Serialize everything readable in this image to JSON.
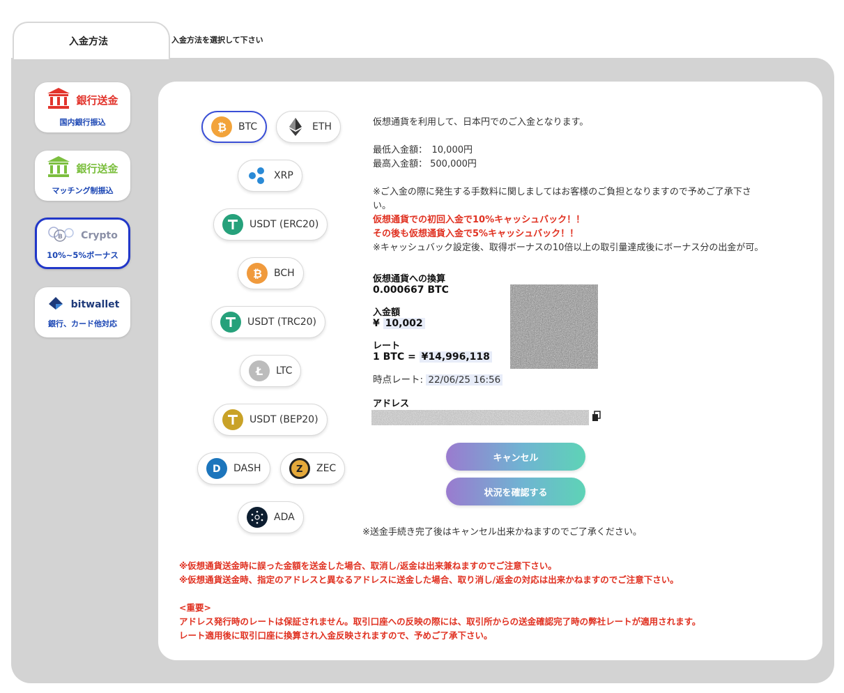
{
  "tabs": {
    "active_label": "入金方法",
    "hint": "入金方法を選択して下さい"
  },
  "methods": [
    {
      "name": "銀行送金",
      "sub": "国内銀行振込",
      "icon": "bank-icon"
    },
    {
      "name": "銀行送金",
      "sub": "マッチング制振込",
      "icon": "bank-icon"
    },
    {
      "name": "Crypto",
      "sub": "10%~5%ボーナス",
      "icon": "crypto-coins-icon",
      "selected": true
    },
    {
      "name": "bitwallet",
      "sub": "銀行、カード他対応",
      "icon": "bitwallet-icon"
    }
  ],
  "coins": [
    {
      "label": "BTC",
      "icon": "bitcoin-icon",
      "color": "#f2a33a",
      "selected": true
    },
    {
      "label": "ETH",
      "icon": "ethereum-icon",
      "color": "#3c3c3d"
    },
    {
      "label": "XRP",
      "icon": "xrp-icon",
      "color": "#2a8ad6"
    },
    {
      "label": "USDT (ERC20)",
      "icon": "tether-icon",
      "color": "#26a17b"
    },
    {
      "label": "BCH",
      "icon": "bitcoin-cash-icon",
      "color": "#f09a3c"
    },
    {
      "label": "USDT (TRC20)",
      "icon": "tether-tron-icon",
      "color": "#26a17b"
    },
    {
      "label": "LTC",
      "icon": "litecoin-icon",
      "color": "#bcbcbc"
    },
    {
      "label": "USDT (BEP20)",
      "icon": "tether-bep20-icon",
      "color": "#c9a227"
    },
    {
      "label": "DASH",
      "icon": "dash-icon",
      "color": "#1c75bc"
    },
    {
      "label": "ZEC",
      "icon": "zcash-icon",
      "color": "#e5a93b"
    },
    {
      "label": "ADA",
      "icon": "cardano-icon",
      "color": "#0d1e30"
    }
  ],
  "info": {
    "intro": "仮想通貨を利用して、日本円でのご入金となります。",
    "min_deposit": "最低入金額：　10,000円",
    "max_deposit": "最高入金額：  500,000円",
    "fee_note_1": "※ご入金の際に発生する手数料に関しましてはお客様のご負担となりますので予めご了承下さ",
    "fee_note_2": "い。",
    "cashback_1": "仮想通貨での初回入金で10%キャッシュバック！！",
    "cashback_2": "その後も仮想通貨入金で5%キャッシュバック！！",
    "cashback_note": "※キャッシュバック設定後、取得ボーナスの10倍以上の取引量達成後にボーナス分の出金が可。"
  },
  "conversion": {
    "label": "仮想通貨への換算",
    "value": "0.000667 BTC",
    "deposit_label": "入金額",
    "deposit_currency": "¥",
    "deposit_value": "10,002",
    "rate_label": "レート",
    "rate_prefix": "1 BTC =",
    "rate_value": "¥14,996,118",
    "rate_time_label": "時点レート:",
    "rate_time_value": "22/06/25 16:56",
    "address_label": "アドレス"
  },
  "buttons": {
    "cancel": "キャンセル",
    "status": "状況を確認する"
  },
  "cancel_note": "※送金手続き完了後はキャンセル出来かねますのでご了承ください。",
  "warnings": {
    "line1": "※仮想通貨送金時に誤った金額を送金した場合、取消し/返金は出来兼ねますのでご注意下さい。",
    "line2": "※仮想通貨送金時、指定のアドレスと異なるアドレスに送金した場合、取り消し/返金の対応は出来かねますのでご注意下さい。",
    "important_title": "<重要>",
    "important_1": "アドレス発行時のレートは保証されません。取引口座への反映の際には、取引所からの送金確認完了時の弊社レートが適用されます。",
    "important_2": "レート適用後に取引口座に換算され入金反映されますので、予めご了承下さい。"
  },
  "colors": {
    "selected_border": "#2137c9",
    "warning_red": "#e03121",
    "frame_grey": "#d3d3d3"
  }
}
